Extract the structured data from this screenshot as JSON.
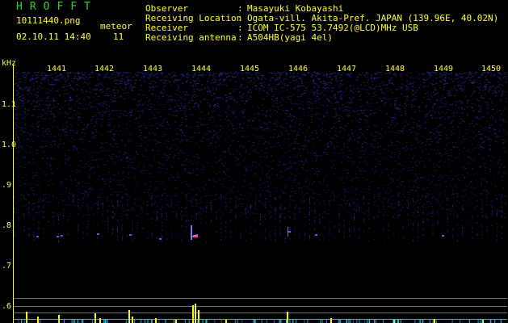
{
  "header": {
    "logo": "HROFFT",
    "filename": "10111440.png",
    "datetime": "02.10.11 14:40",
    "meteor_label": "meteor",
    "meteor_count": "11",
    "fields": [
      {
        "label": "Observer",
        "sep": ":",
        "value": "Masayuki Kobayashi"
      },
      {
        "label": "Receiving Location",
        "sep": ":",
        "value": "Ogata-vill. Akita-Pref. JAPAN (139.96E, 40.02N)"
      },
      {
        "label": "Receiver",
        "sep": ":",
        "value": "ICOM IC-575 53.7492(@LCD)MHz USB"
      },
      {
        "label": "Receiving antenna",
        "sep": ":",
        "value": "A504HB(yagi 4el)"
      }
    ]
  },
  "axes": {
    "y_unit": "kHz",
    "y_ticks": [
      "1.1",
      "1.0",
      ".9",
      ".8",
      ".7",
      ".6"
    ],
    "x_ticks": [
      "1441",
      "1442",
      "1443",
      "1444",
      "1445",
      "1446",
      "1447",
      "1448",
      "1449",
      "1450"
    ]
  },
  "colors": {
    "text": "#ffff33",
    "logo": "#22dd22",
    "background": "#000000",
    "noise": "#2a2a9a",
    "echo": "#ff44aa",
    "signal_bar": "#ffff00",
    "baseline": "#00ffff"
  }
}
